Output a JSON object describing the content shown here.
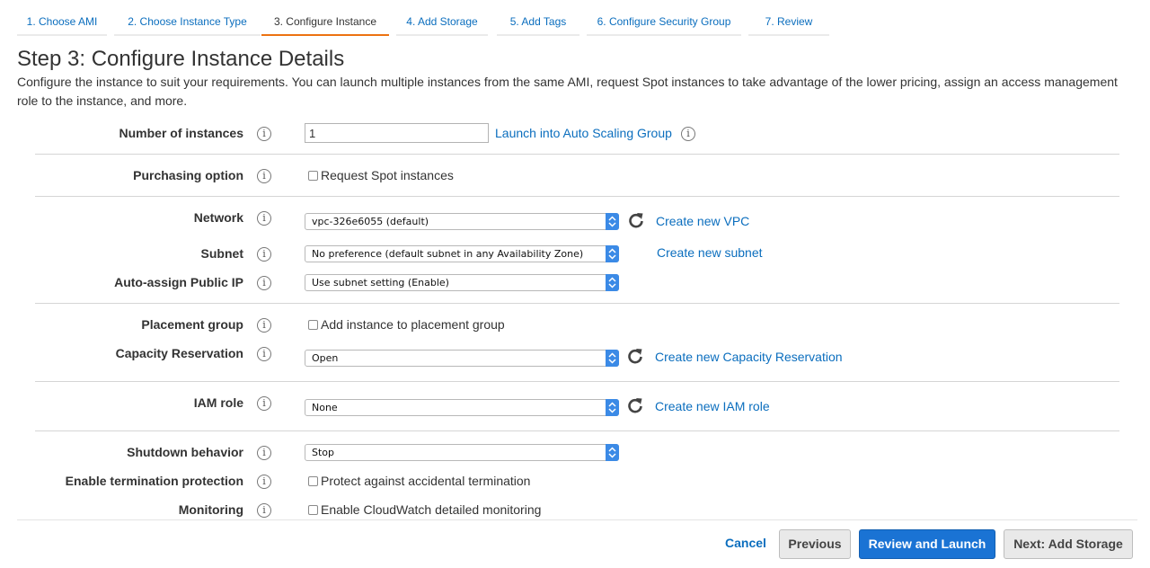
{
  "wizard": {
    "tabs": [
      {
        "label": "1. Choose AMI"
      },
      {
        "label": "2. Choose Instance Type"
      },
      {
        "label": "3. Configure Instance"
      },
      {
        "label": "4. Add Storage"
      },
      {
        "label": "5. Add Tags"
      },
      {
        "label": "6. Configure Security Group"
      },
      {
        "label": "7. Review"
      }
    ],
    "active_tab": "3. Configure Instance"
  },
  "page": {
    "title": "Step 3: Configure Instance Details",
    "description": "Configure the instance to suit your requirements. You can launch multiple instances from the same AMI, request Spot instances to take advantage of the lower pricing, assign an access management role to the instance, and more."
  },
  "form": {
    "info_glyph": "i",
    "number_of_instances": {
      "label": "Number of instances",
      "value": "1",
      "link": "Launch into Auto Scaling Group"
    },
    "purchasing_option": {
      "label": "Purchasing option",
      "checkbox": "Request Spot instances",
      "checked": false
    },
    "network": {
      "label": "Network",
      "value": "vpc-326e6055 (default)",
      "link": "Create new VPC"
    },
    "subnet": {
      "label": "Subnet",
      "value": "No preference (default subnet in any Availability Zone)",
      "link": "Create new subnet"
    },
    "auto_assign_ip": {
      "label": "Auto-assign Public IP",
      "value": "Use subnet setting (Enable)"
    },
    "placement_group": {
      "label": "Placement group",
      "checkbox": "Add instance to placement group",
      "checked": false
    },
    "capacity_reservation": {
      "label": "Capacity Reservation",
      "value": "Open",
      "link": "Create new Capacity Reservation"
    },
    "iam_role": {
      "label": "IAM role",
      "value": "None",
      "link": "Create new IAM role"
    },
    "shutdown_behavior": {
      "label": "Shutdown behavior",
      "value": "Stop"
    },
    "termination_protection": {
      "label": "Enable termination protection",
      "checkbox": "Protect against accidental termination",
      "checked": false
    },
    "monitoring": {
      "label": "Monitoring",
      "checkbox": "Enable CloudWatch detailed monitoring",
      "checked": false
    }
  },
  "footer": {
    "cancel": "Cancel",
    "previous": "Previous",
    "review_launch": "Review and Launch",
    "next": "Next: Add Storage"
  },
  "colors": {
    "link": "#0b6ebe",
    "active_tab_underline": "#ec7211",
    "primary_button": "#1a73d4",
    "select_arrow": "#3b8ae6"
  },
  "icons": [
    "info-icon",
    "refresh-icon",
    "select-arrows-icon"
  ]
}
